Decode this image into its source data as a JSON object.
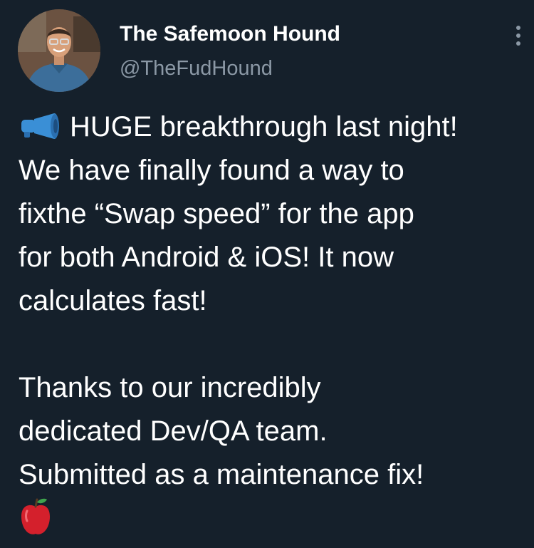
{
  "author": {
    "display_name": "The Safemoon Hound",
    "handle": "@TheFudHound",
    "avatar_icon": "profile-photo"
  },
  "menu": {
    "icon": "more-vertical-icon"
  },
  "tweet": {
    "lead_icon": "megaphone-icon",
    "lines": [
      "HUGE breakthrough last night!",
      "We have finally found a way to",
      "fixthe “Swap speed” for the app",
      "for both Android & iOS! It now",
      "calculates fast!",
      "",
      "Thanks to our incredibly",
      "dedicated Dev/QA team.",
      "Submitted as a maintenance fix!"
    ],
    "trailing_icon": "red-apple-icon"
  },
  "colors": {
    "background": "#15202b",
    "text": "#ffffff",
    "secondary_text": "#8b98a5",
    "megaphone": "#3a8fd6",
    "apple": "#d4202c"
  }
}
